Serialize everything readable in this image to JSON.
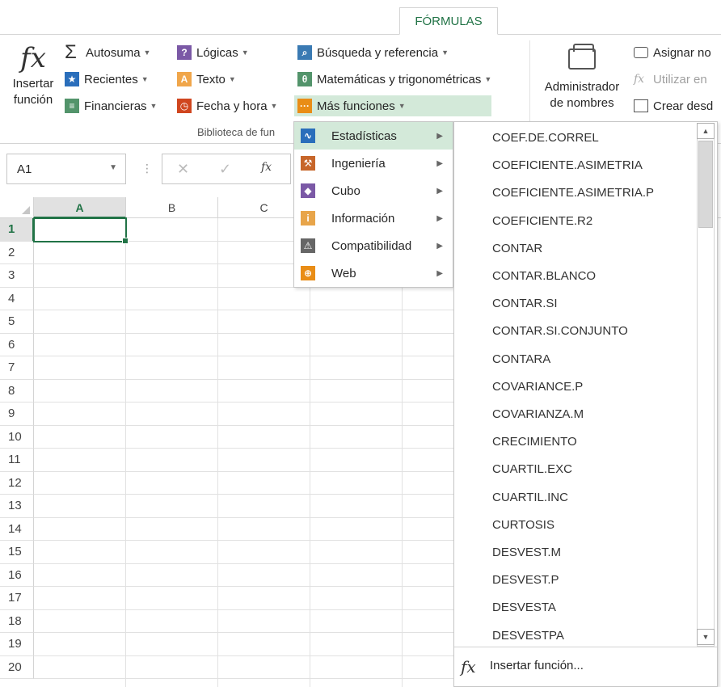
{
  "tab": {
    "formulas_label": "FÓRMULAS"
  },
  "ribbon": {
    "insert_function": {
      "line1": "Insertar",
      "line2": "función",
      "glyph": "fx"
    },
    "col1": [
      {
        "label": "Autosuma",
        "icon": "sigma-icon"
      },
      {
        "label": "Recientes",
        "icon": "star-icon"
      },
      {
        "label": "Financieras",
        "icon": "book-icon"
      }
    ],
    "col2": [
      {
        "label": "Lógicas",
        "icon": "question-icon"
      },
      {
        "label": "Texto",
        "icon": "text-icon"
      },
      {
        "label": "Fecha y hora",
        "icon": "clock-icon"
      }
    ],
    "col3": [
      {
        "label": "Búsqueda y referencia",
        "icon": "search-icon"
      },
      {
        "label": "Matemáticas y trigonométricas",
        "icon": "theta-icon"
      },
      {
        "label": "Más funciones",
        "icon": "more-functions-icon"
      }
    ],
    "group_label": "Biblioteca de fun",
    "name_manager": {
      "line1": "Administrador",
      "line2": "de nombres"
    },
    "names_col": [
      {
        "label": "Asignar no"
      },
      {
        "label": "Utilizar en"
      },
      {
        "label": "Crear desd"
      }
    ]
  },
  "formula_bar": {
    "name_box": "A1",
    "fx": "fx"
  },
  "grid": {
    "columns": [
      "A",
      "B",
      "C"
    ],
    "rows": [
      "1",
      "2",
      "3",
      "4",
      "5",
      "6",
      "7",
      "8",
      "9",
      "10",
      "11",
      "12",
      "13",
      "14",
      "15",
      "16",
      "17",
      "18",
      "19",
      "20"
    ]
  },
  "submenu": [
    {
      "label": "Estadísticas",
      "icon": "statistics-icon",
      "active": true
    },
    {
      "label": "Ingeniería",
      "icon": "engineering-icon"
    },
    {
      "label": "Cubo",
      "icon": "cube-icon"
    },
    {
      "label": "Información",
      "icon": "information-icon"
    },
    {
      "label": "Compatibilidad",
      "icon": "compatibility-icon"
    },
    {
      "label": "Web",
      "icon": "web-icon"
    }
  ],
  "functions": [
    "COEF.DE.CORREL",
    "COEFICIENTE.ASIMETRIA",
    "COEFICIENTE.ASIMETRIA.P",
    "COEFICIENTE.R2",
    "CONTAR",
    "CONTAR.BLANCO",
    "CONTAR.SI",
    "CONTAR.SI.CONJUNTO",
    "CONTARA",
    "COVARIANCE.P",
    "COVARIANZA.M",
    "CRECIMIENTO",
    "CUARTIL.EXC",
    "CUARTIL.INC",
    "CURTOSIS",
    "DESVEST.M",
    "DESVEST.P",
    "DESVESTA",
    "DESVESTPA"
  ],
  "insert_function_item": {
    "label": "Insertar función...",
    "glyph": "fx"
  },
  "colors": {
    "accent": "#217346",
    "highlight": "#d3e9d9",
    "selection_border": "#217346"
  }
}
